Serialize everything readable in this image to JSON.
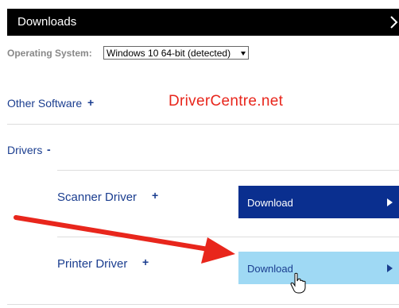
{
  "header": {
    "title": "Downloads"
  },
  "os": {
    "label": "Operating System:",
    "selected": "Windows 10 64-bit (detected)"
  },
  "watermark": "DriverCentre.net",
  "sections": {
    "other_software": {
      "label": "Other Software",
      "toggle": "+"
    },
    "drivers": {
      "label": "Drivers",
      "toggle": "-"
    }
  },
  "drivers": [
    {
      "label": "Scanner Driver",
      "toggle": "+",
      "button": "Download"
    },
    {
      "label": "Printer Driver",
      "toggle": "+",
      "button": "Download"
    }
  ],
  "colors": {
    "header_bg": "#000000",
    "link": "#1a3d8f",
    "download_dark": "#0a2f8f",
    "download_hover": "#9fd9f4",
    "annotation_arrow": "#e8261c"
  },
  "icons": [
    "chevron-right-icon",
    "dropdown-arrow-icon",
    "play-arrow-icon",
    "hand-cursor-icon",
    "annotation-arrow"
  ]
}
